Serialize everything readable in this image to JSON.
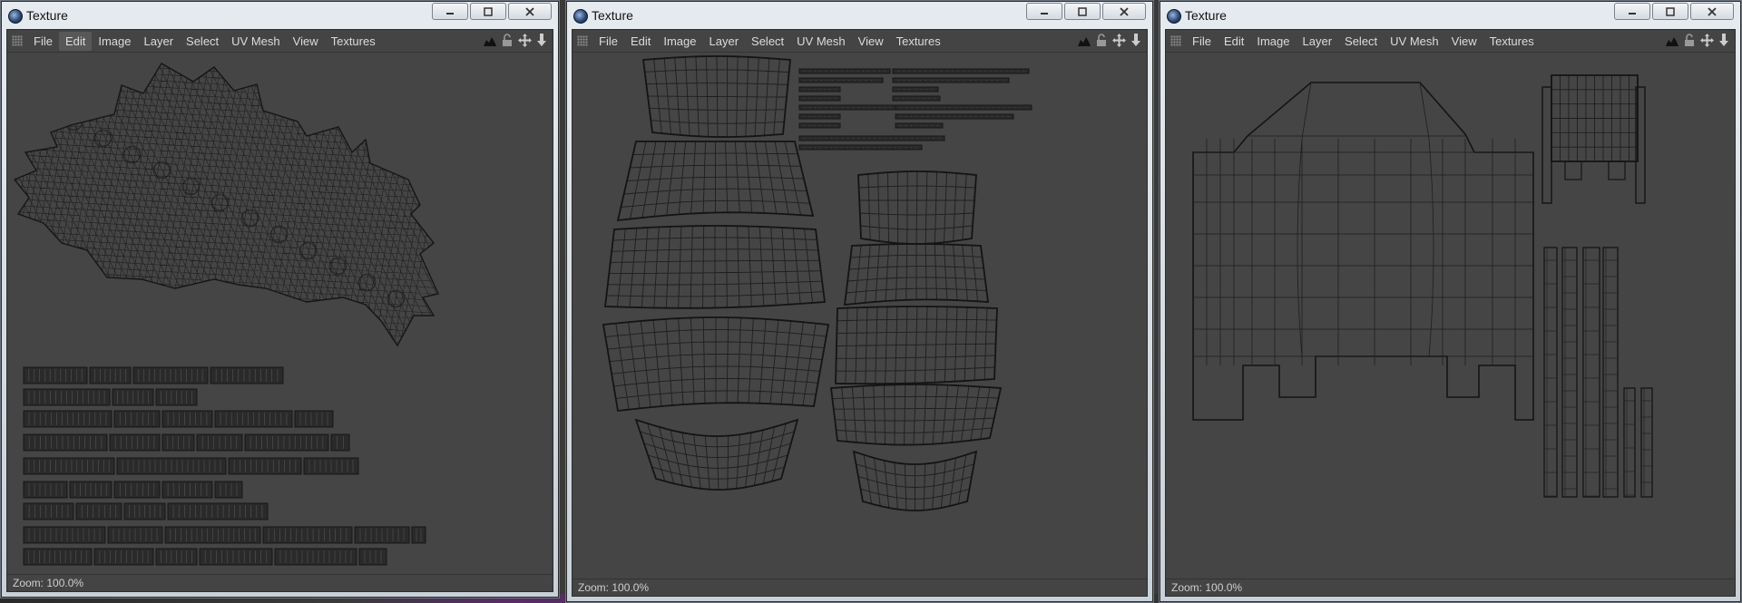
{
  "windows": [
    {
      "title": "Texture",
      "menu": [
        "File",
        "Edit",
        "Image",
        "Layer",
        "Select",
        "UV Mesh",
        "View",
        "Textures"
      ],
      "active_menu": "Edit",
      "status": "Zoom: 100.0%"
    },
    {
      "title": "Texture",
      "menu": [
        "File",
        "Edit",
        "Image",
        "Layer",
        "Select",
        "UV Mesh",
        "View",
        "Textures"
      ],
      "active_menu": null,
      "status": "Zoom: 100.0%"
    },
    {
      "title": "Texture",
      "menu": [
        "File",
        "Edit",
        "Image",
        "Layer",
        "Select",
        "UV Mesh",
        "View",
        "Textures"
      ],
      "active_menu": null,
      "status": "Zoom: 100.0%"
    }
  ],
  "toolbar_icons": [
    "histogram-icon",
    "lock-icon",
    "move-icon",
    "download-icon"
  ],
  "colors": {
    "canvas": "#454545",
    "wire": "#1e1e1e",
    "chrome": "#444444",
    "menu_text": "#dcdcdc"
  }
}
